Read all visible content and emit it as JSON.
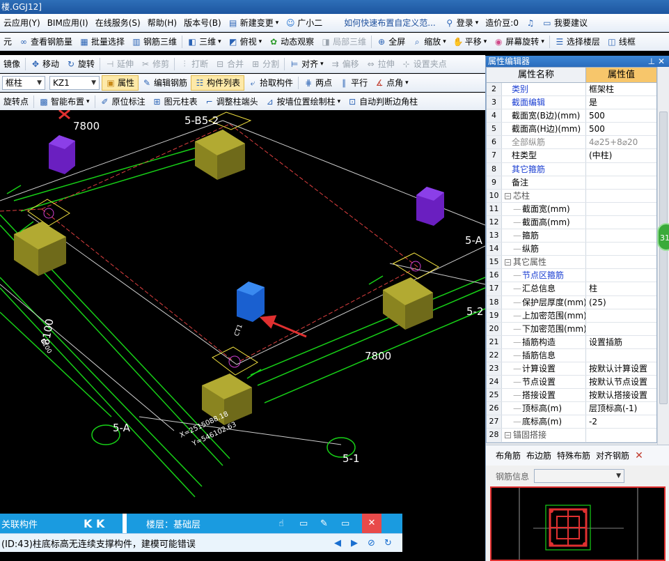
{
  "window": {
    "title": "楼.GGJ12]"
  },
  "menu": {
    "items": [
      "云应用(Y)",
      "BIM应用(I)",
      "在线服务(S)",
      "帮助(H)",
      "版本号(B)"
    ],
    "new_change": "新建变更",
    "guang_xiao_er": "广小二",
    "tip_link": "如何快速布置自定义范...",
    "login": "登录",
    "zaojiadou": "造价豆:0",
    "suggest": "我要建议"
  },
  "toolbar1": {
    "items": [
      "元",
      "查看钢筋量",
      "批量选择",
      "钢筋三维",
      "三维",
      "俯视",
      "动态观察",
      "局部三维",
      "全屏",
      "缩放",
      "平移",
      "屏幕旋转",
      "选择楼层",
      "线框"
    ]
  },
  "toolbar2": {
    "items": [
      "镜像",
      "移动",
      "旋转",
      "延伸",
      "修剪",
      "打断",
      "合并",
      "分割",
      "对齐",
      "偏移",
      "拉伸",
      "设置夹点"
    ]
  },
  "toolbar3": {
    "type_combo": "框柱",
    "name_combo": "KZ1",
    "items": [
      "属性",
      "编辑钢筋",
      "构件列表",
      "拾取构件",
      "两点",
      "平行",
      "点角"
    ]
  },
  "toolbar4": {
    "items": [
      "旋转点",
      "智能布置",
      "原位标注",
      "图元柱表",
      "调整柱端头",
      "按墙位置绘制柱",
      "自动判断边角柱"
    ]
  },
  "viewport": {
    "labels": {
      "dim_top": "7800",
      "dim_mid": "7800",
      "dim_left": "8100",
      "dim_left_small": "8100",
      "axis_5b5_2": "5-B5-2",
      "axis_5a_left": "5-A",
      "axis_5a_right": "5-A",
      "axis_5_2": "5-2",
      "axis_5_1": "5-1",
      "coord_x": "X=2515088.18",
      "coord_y": "Y=546102.63",
      "col_tag": "CT1"
    }
  },
  "status": {
    "linked": "关联构件",
    "floor": "楼层：基础层",
    "message": "(ID:43)柱底标高无连续支撑构件，建模可能错误"
  },
  "property_panel": {
    "title": "属性编辑器",
    "col_name": "属性名称",
    "col_value": "属性值",
    "rows": [
      {
        "n": "2",
        "name": "类别",
        "value": "框架柱",
        "style": "blue"
      },
      {
        "n": "3",
        "name": "截面编辑",
        "value": "是",
        "style": "blue"
      },
      {
        "n": "4",
        "name": "截面宽(B边)(mm)",
        "value": "500",
        "style": ""
      },
      {
        "n": "5",
        "name": "截面高(H边)(mm)",
        "value": "500",
        "style": ""
      },
      {
        "n": "6",
        "name": "全部纵筋",
        "value": "4⌀25+8⌀20",
        "style": "gray"
      },
      {
        "n": "7",
        "name": "柱类型",
        "value": "(中柱)",
        "style": ""
      },
      {
        "n": "8",
        "name": "其它箍筋",
        "value": "",
        "style": "blue"
      },
      {
        "n": "9",
        "name": "备注",
        "value": "",
        "style": ""
      },
      {
        "n": "10",
        "name": "芯柱",
        "value": "",
        "style": "group"
      },
      {
        "n": "11",
        "name": "截面宽(mm)",
        "value": "",
        "style": "indent"
      },
      {
        "n": "12",
        "name": "截面高(mm)",
        "value": "",
        "style": "indent"
      },
      {
        "n": "13",
        "name": "箍筋",
        "value": "",
        "style": "indent"
      },
      {
        "n": "14",
        "name": "纵筋",
        "value": "",
        "style": "indent"
      },
      {
        "n": "15",
        "name": "其它属性",
        "value": "",
        "style": "group"
      },
      {
        "n": "16",
        "name": "节点区箍筋",
        "value": "",
        "style": "indent-blue"
      },
      {
        "n": "17",
        "name": "汇总信息",
        "value": "柱",
        "style": "indent"
      },
      {
        "n": "18",
        "name": "保护层厚度(mm)",
        "value": "(25)",
        "style": "indent"
      },
      {
        "n": "19",
        "name": "上加密范围(mm)",
        "value": "",
        "style": "indent"
      },
      {
        "n": "20",
        "name": "下加密范围(mm)",
        "value": "",
        "style": "indent"
      },
      {
        "n": "21",
        "name": "插筋构造",
        "value": "设置插筋",
        "style": "indent"
      },
      {
        "n": "22",
        "name": "插筋信息",
        "value": "",
        "style": "indent"
      },
      {
        "n": "23",
        "name": "计算设置",
        "value": "按默认计算设置",
        "style": "indent"
      },
      {
        "n": "24",
        "name": "节点设置",
        "value": "按默认节点设置",
        "style": "indent"
      },
      {
        "n": "25",
        "name": "搭接设置",
        "value": "按默认搭接设置",
        "style": "indent"
      },
      {
        "n": "26",
        "name": "顶标高(m)",
        "value": "层顶标高(-1)",
        "style": "indent"
      },
      {
        "n": "27",
        "name": "底标高(m)",
        "value": "-2",
        "style": "indent"
      },
      {
        "n": "28",
        "name": "锚固搭接",
        "value": "",
        "style": "group"
      }
    ],
    "rebar_tabs": [
      "布角筋",
      "布边筋",
      "特殊布筋",
      "对齐钢筋"
    ],
    "rebar_info_label": "钢筋信息",
    "bubble": "31"
  },
  "colors": {
    "accent": "#1a9be0",
    "title": "#1d56a0",
    "header_value": "#f7c66b"
  }
}
